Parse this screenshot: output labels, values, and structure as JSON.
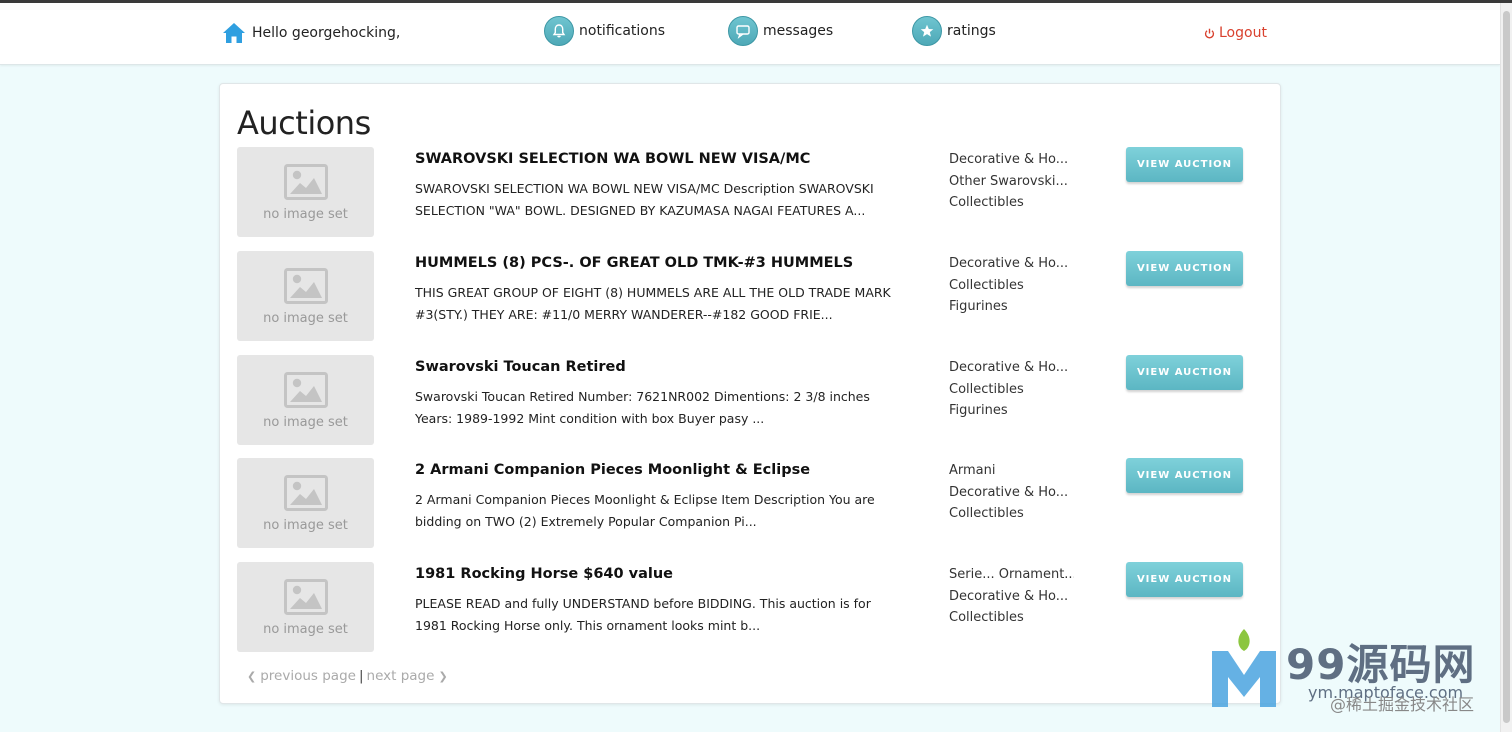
{
  "nav": {
    "greeting": "Hello georgehocking,",
    "notifications": "notifications",
    "messages": "messages",
    "ratings": "ratings",
    "logout": "Logout"
  },
  "page": {
    "title": "Auctions"
  },
  "auctions": [
    {
      "thumb_label": "no image set",
      "title": "SWAROVSKI SELECTION WA BOWL NEW VISA/MC",
      "description": "SWAROVSKI SELECTION WA BOWL NEW VISA/MC Description SWAROVSKI SELECTION \"WA\" BOWL. DESIGNED BY KAZUMASA NAGAI FEATURES A...",
      "categories": [
        "Decorative & Ho...",
        "Other Swarovski...",
        "Collectibles"
      ],
      "button": "VIEW AUCTION"
    },
    {
      "thumb_label": "no image set",
      "title": "HUMMELS (8) PCS-. OF GREAT OLD TMK-#3 HUMMELS",
      "description": "THIS GREAT GROUP OF EIGHT (8) HUMMELS ARE ALL THE OLD TRADE MARK #3(STY.) THEY ARE: #11/0 MERRY WANDERER--#182 GOOD FRIE...",
      "categories": [
        "Decorative & Ho...",
        "Collectibles",
        "Figurines"
      ],
      "button": "VIEW AUCTION"
    },
    {
      "thumb_label": "no image set",
      "title": "Swarovski Toucan Retired",
      "description": "Swarovski Toucan Retired Number: 7621NR002 Dimentions: 2 3/8 inches Years: 1989-1992 Mint condition with box Buyer pasy ...",
      "categories": [
        "Decorative & Ho...",
        "Collectibles",
        "Figurines"
      ],
      "button": "VIEW AUCTION"
    },
    {
      "thumb_label": "no image set",
      "title": "2 Armani Companion Pieces Moonlight & Eclipse",
      "description": "2 Armani Companion Pieces Moonlight & Eclipse Item Description You are bidding on TWO (2) Extremely Popular Companion Pi...",
      "categories": [
        "Armani",
        "Decorative & Ho...",
        "Collectibles"
      ],
      "button": "VIEW AUCTION"
    },
    {
      "thumb_label": "no image set",
      "title": "1981 Rocking Horse $640 value",
      "description": "PLEASE READ and fully UNDERSTAND before BIDDING. This auction is for 1981 Rocking Horse only. This ornament looks mint b...",
      "categories": [
        "Serie... Ornament...",
        "Decorative & Ho...",
        "Collectibles"
      ],
      "button": "VIEW AUCTION"
    }
  ],
  "pager": {
    "previous": "previous page",
    "separator": "|",
    "next": "next page"
  },
  "watermark": {
    "brand": "99源码网",
    "url": "ym.maptoface.com",
    "sub": "@稀土掘金技术社区"
  },
  "colors": {
    "accent": "#5cb6c3",
    "logout": "#d9412e",
    "background": "#eefbfc"
  }
}
